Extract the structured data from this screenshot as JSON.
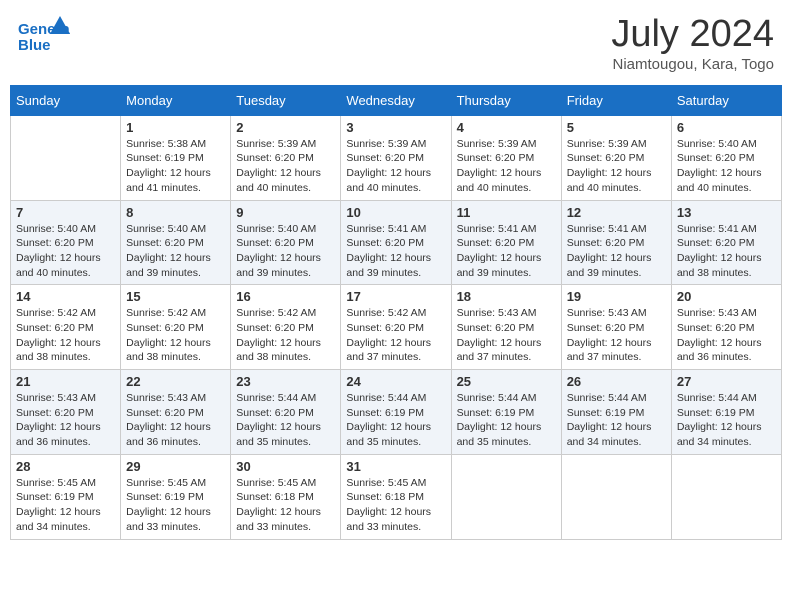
{
  "header": {
    "logo_line1": "General",
    "logo_line2": "Blue",
    "title": "July 2024",
    "subtitle": "Niamtougou, Kara, Togo"
  },
  "days_of_week": [
    "Sunday",
    "Monday",
    "Tuesday",
    "Wednesday",
    "Thursday",
    "Friday",
    "Saturday"
  ],
  "weeks": [
    [
      {
        "day": "",
        "info": ""
      },
      {
        "day": "1",
        "info": "Sunrise: 5:38 AM\nSunset: 6:19 PM\nDaylight: 12 hours\nand 41 minutes."
      },
      {
        "day": "2",
        "info": "Sunrise: 5:39 AM\nSunset: 6:20 PM\nDaylight: 12 hours\nand 40 minutes."
      },
      {
        "day": "3",
        "info": "Sunrise: 5:39 AM\nSunset: 6:20 PM\nDaylight: 12 hours\nand 40 minutes."
      },
      {
        "day": "4",
        "info": "Sunrise: 5:39 AM\nSunset: 6:20 PM\nDaylight: 12 hours\nand 40 minutes."
      },
      {
        "day": "5",
        "info": "Sunrise: 5:39 AM\nSunset: 6:20 PM\nDaylight: 12 hours\nand 40 minutes."
      },
      {
        "day": "6",
        "info": "Sunrise: 5:40 AM\nSunset: 6:20 PM\nDaylight: 12 hours\nand 40 minutes."
      }
    ],
    [
      {
        "day": "7",
        "info": "Sunrise: 5:40 AM\nSunset: 6:20 PM\nDaylight: 12 hours\nand 40 minutes."
      },
      {
        "day": "8",
        "info": "Sunrise: 5:40 AM\nSunset: 6:20 PM\nDaylight: 12 hours\nand 39 minutes."
      },
      {
        "day": "9",
        "info": "Sunrise: 5:40 AM\nSunset: 6:20 PM\nDaylight: 12 hours\nand 39 minutes."
      },
      {
        "day": "10",
        "info": "Sunrise: 5:41 AM\nSunset: 6:20 PM\nDaylight: 12 hours\nand 39 minutes."
      },
      {
        "day": "11",
        "info": "Sunrise: 5:41 AM\nSunset: 6:20 PM\nDaylight: 12 hours\nand 39 minutes."
      },
      {
        "day": "12",
        "info": "Sunrise: 5:41 AM\nSunset: 6:20 PM\nDaylight: 12 hours\nand 39 minutes."
      },
      {
        "day": "13",
        "info": "Sunrise: 5:41 AM\nSunset: 6:20 PM\nDaylight: 12 hours\nand 38 minutes."
      }
    ],
    [
      {
        "day": "14",
        "info": "Sunrise: 5:42 AM\nSunset: 6:20 PM\nDaylight: 12 hours\nand 38 minutes."
      },
      {
        "day": "15",
        "info": "Sunrise: 5:42 AM\nSunset: 6:20 PM\nDaylight: 12 hours\nand 38 minutes."
      },
      {
        "day": "16",
        "info": "Sunrise: 5:42 AM\nSunset: 6:20 PM\nDaylight: 12 hours\nand 38 minutes."
      },
      {
        "day": "17",
        "info": "Sunrise: 5:42 AM\nSunset: 6:20 PM\nDaylight: 12 hours\nand 37 minutes."
      },
      {
        "day": "18",
        "info": "Sunrise: 5:43 AM\nSunset: 6:20 PM\nDaylight: 12 hours\nand 37 minutes."
      },
      {
        "day": "19",
        "info": "Sunrise: 5:43 AM\nSunset: 6:20 PM\nDaylight: 12 hours\nand 37 minutes."
      },
      {
        "day": "20",
        "info": "Sunrise: 5:43 AM\nSunset: 6:20 PM\nDaylight: 12 hours\nand 36 minutes."
      }
    ],
    [
      {
        "day": "21",
        "info": "Sunrise: 5:43 AM\nSunset: 6:20 PM\nDaylight: 12 hours\nand 36 minutes."
      },
      {
        "day": "22",
        "info": "Sunrise: 5:43 AM\nSunset: 6:20 PM\nDaylight: 12 hours\nand 36 minutes."
      },
      {
        "day": "23",
        "info": "Sunrise: 5:44 AM\nSunset: 6:20 PM\nDaylight: 12 hours\nand 35 minutes."
      },
      {
        "day": "24",
        "info": "Sunrise: 5:44 AM\nSunset: 6:19 PM\nDaylight: 12 hours\nand 35 minutes."
      },
      {
        "day": "25",
        "info": "Sunrise: 5:44 AM\nSunset: 6:19 PM\nDaylight: 12 hours\nand 35 minutes."
      },
      {
        "day": "26",
        "info": "Sunrise: 5:44 AM\nSunset: 6:19 PM\nDaylight: 12 hours\nand 34 minutes."
      },
      {
        "day": "27",
        "info": "Sunrise: 5:44 AM\nSunset: 6:19 PM\nDaylight: 12 hours\nand 34 minutes."
      }
    ],
    [
      {
        "day": "28",
        "info": "Sunrise: 5:45 AM\nSunset: 6:19 PM\nDaylight: 12 hours\nand 34 minutes."
      },
      {
        "day": "29",
        "info": "Sunrise: 5:45 AM\nSunset: 6:19 PM\nDaylight: 12 hours\nand 33 minutes."
      },
      {
        "day": "30",
        "info": "Sunrise: 5:45 AM\nSunset: 6:18 PM\nDaylight: 12 hours\nand 33 minutes."
      },
      {
        "day": "31",
        "info": "Sunrise: 5:45 AM\nSunset: 6:18 PM\nDaylight: 12 hours\nand 33 minutes."
      },
      {
        "day": "",
        "info": ""
      },
      {
        "day": "",
        "info": ""
      },
      {
        "day": "",
        "info": ""
      }
    ]
  ]
}
